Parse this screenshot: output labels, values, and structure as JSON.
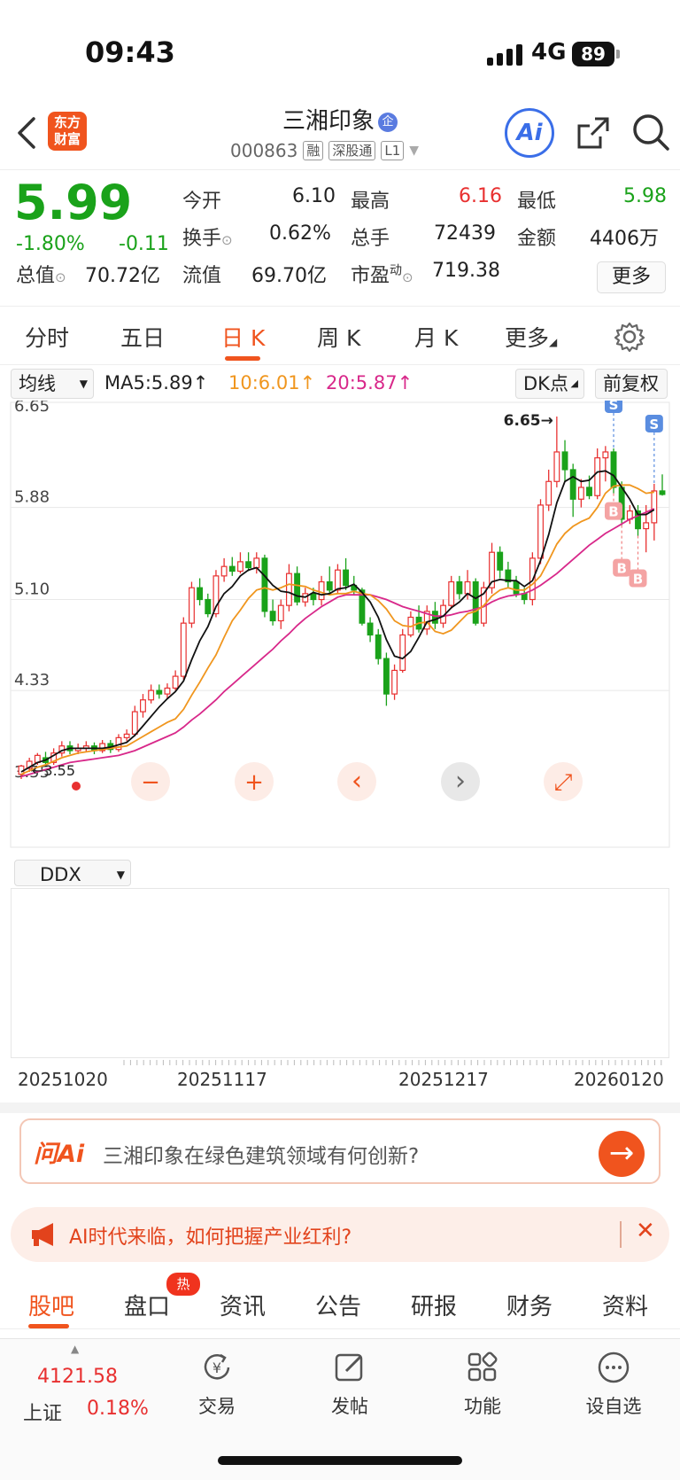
{
  "status": {
    "time": "09:43",
    "network": "4G",
    "battery": "89"
  },
  "header": {
    "logo_text": "东方财富",
    "title": "三湘印象",
    "badge": "企",
    "code": "000863",
    "tags": [
      "融",
      "深股通",
      "L1"
    ],
    "ai_label": "Ai"
  },
  "quote": {
    "price": "5.99",
    "pct": "-1.80%",
    "change": "-0.11",
    "rows": [
      [
        {
          "l": "今开",
          "v": "6.10",
          "c": "normal"
        },
        {
          "l": "最高",
          "v": "6.16",
          "c": "red"
        },
        {
          "l": "最低",
          "v": "5.98",
          "c": "green"
        }
      ],
      [
        {
          "l": "换手",
          "v": "0.62%",
          "c": "normal"
        },
        {
          "l": "总手",
          "v": "72439",
          "c": "normal"
        },
        {
          "l": "金额",
          "v": "4406万",
          "c": "normal"
        }
      ]
    ],
    "total_label": "总值",
    "total_value": "70.72亿",
    "float_label": "流值",
    "float_value": "69.70亿",
    "pe_label": "市盈",
    "pe_sup": "动",
    "pe_value": "719.38",
    "more_button": "更多"
  },
  "tabs": [
    "分时",
    "五日",
    "日 K",
    "周 K",
    "月 K",
    "更多"
  ],
  "active_tab": "日 K",
  "ma_bar": {
    "selector": "均线",
    "ma5": "MA5:5.89",
    "ma10": "10:6.01",
    "ma20": "20:5.87",
    "dk": "DK点",
    "adjust": "前复权"
  },
  "colors": {
    "up": "#e83030",
    "down": "#1aa21a",
    "ma5": "#111111",
    "ma10": "#f0961e",
    "ma20": "#d8288a",
    "accent": "#f0541e"
  },
  "chart_data": {
    "type": "candlestick",
    "y_ticks": [
      "6.65",
      "5.88",
      "5.10",
      "4.33",
      "3.55"
    ],
    "ylim": [
      3.55,
      6.65
    ],
    "max_marker": "6.65",
    "min_marker": "3.55",
    "x_ticks": [
      "20251020",
      "20251117",
      "20251217",
      "20260120"
    ],
    "candles": [
      [
        3.62,
        3.69,
        3.7,
        3.58
      ],
      [
        3.67,
        3.73,
        3.76,
        3.64
      ],
      [
        3.72,
        3.78,
        3.8,
        3.7
      ],
      [
        3.76,
        3.72,
        3.81,
        3.7
      ],
      [
        3.72,
        3.8,
        3.84,
        3.7
      ],
      [
        3.8,
        3.86,
        3.9,
        3.77
      ],
      [
        3.86,
        3.82,
        3.9,
        3.79
      ],
      [
        3.82,
        3.84,
        3.88,
        3.79
      ],
      [
        3.84,
        3.86,
        3.9,
        3.81
      ],
      [
        3.86,
        3.82,
        3.89,
        3.79
      ],
      [
        3.82,
        3.88,
        3.91,
        3.8
      ],
      [
        3.88,
        3.83,
        3.91,
        3.8
      ],
      [
        3.83,
        3.93,
        3.96,
        3.81
      ],
      [
        3.93,
        3.96,
        4.0,
        3.9
      ],
      [
        3.96,
        4.15,
        4.2,
        3.94
      ],
      [
        4.15,
        4.25,
        4.3,
        4.1
      ],
      [
        4.25,
        4.33,
        4.38,
        4.22
      ],
      [
        4.33,
        4.3,
        4.38,
        4.26
      ],
      [
        4.3,
        4.35,
        4.39,
        4.26
      ],
      [
        4.35,
        4.45,
        4.5,
        4.33
      ],
      [
        4.45,
        4.9,
        4.95,
        4.42
      ],
      [
        4.9,
        5.2,
        5.25,
        4.86
      ],
      [
        5.2,
        5.1,
        5.28,
        5.05
      ],
      [
        5.1,
        4.98,
        5.15,
        4.95
      ],
      [
        4.98,
        5.3,
        5.35,
        4.95
      ],
      [
        5.3,
        5.38,
        5.45,
        5.25
      ],
      [
        5.38,
        5.34,
        5.46,
        5.3
      ],
      [
        5.34,
        5.42,
        5.5,
        5.32
      ],
      [
        5.42,
        5.37,
        5.5,
        5.34
      ],
      [
        5.37,
        5.45,
        5.5,
        5.32
      ],
      [
        5.45,
        5.0,
        5.48,
        4.95
      ],
      [
        5.0,
        4.92,
        5.1,
        4.88
      ],
      [
        4.92,
        5.05,
        5.1,
        4.85
      ],
      [
        5.05,
        5.32,
        5.4,
        5.0
      ],
      [
        5.32,
        5.08,
        5.38,
        5.05
      ],
      [
        5.08,
        5.15,
        5.2,
        5.04
      ],
      [
        5.15,
        5.1,
        5.2,
        5.05
      ],
      [
        5.1,
        5.25,
        5.3,
        5.05
      ],
      [
        5.25,
        5.18,
        5.38,
        5.14
      ],
      [
        5.18,
        5.35,
        5.4,
        5.15
      ],
      [
        5.35,
        5.22,
        5.45,
        5.18
      ],
      [
        5.22,
        5.18,
        5.3,
        5.14
      ],
      [
        5.18,
        4.9,
        5.2,
        4.88
      ],
      [
        4.9,
        4.8,
        4.95,
        4.74
      ],
      [
        4.8,
        4.6,
        4.85,
        4.55
      ],
      [
        4.6,
        4.3,
        4.65,
        4.2
      ],
      [
        4.3,
        4.5,
        4.55,
        4.25
      ],
      [
        4.5,
        4.8,
        4.85,
        4.48
      ],
      [
        4.8,
        4.95,
        5.0,
        4.78
      ],
      [
        4.95,
        4.85,
        5.05,
        4.82
      ],
      [
        4.85,
        5.0,
        5.05,
        4.8
      ],
      [
        5.0,
        4.9,
        5.08,
        4.85
      ],
      [
        4.9,
        5.05,
        5.1,
        4.86
      ],
      [
        5.05,
        5.25,
        5.3,
        5.02
      ],
      [
        5.25,
        5.15,
        5.3,
        5.1
      ],
      [
        5.15,
        5.25,
        5.35,
        5.1
      ],
      [
        5.25,
        4.9,
        5.28,
        4.88
      ],
      [
        4.9,
        5.2,
        5.25,
        4.87
      ],
      [
        5.2,
        5.5,
        5.58,
        5.15
      ],
      [
        5.5,
        5.35,
        5.55,
        5.28
      ],
      [
        5.35,
        5.25,
        5.42,
        5.2
      ],
      [
        5.25,
        5.15,
        5.3,
        5.12
      ],
      [
        5.15,
        5.1,
        5.2,
        5.06
      ],
      [
        5.1,
        5.45,
        5.5,
        5.05
      ],
      [
        5.45,
        5.9,
        5.95,
        5.4
      ],
      [
        5.9,
        6.1,
        6.2,
        5.85
      ],
      [
        6.1,
        6.35,
        6.65,
        6.05
      ],
      [
        6.35,
        6.2,
        6.45,
        6.1
      ],
      [
        6.2,
        5.95,
        6.25,
        5.8
      ],
      [
        5.95,
        6.05,
        6.12,
        5.88
      ],
      [
        6.05,
        5.98,
        6.15,
        5.95
      ],
      [
        5.98,
        6.3,
        6.38,
        5.95
      ],
      [
        6.3,
        6.35,
        6.4,
        6.1
      ],
      [
        6.35,
        6.05,
        6.38,
        6.0
      ],
      [
        6.05,
        5.78,
        6.1,
        5.73
      ],
      [
        5.78,
        5.85,
        5.9,
        5.74
      ],
      [
        5.85,
        5.7,
        5.9,
        5.64
      ],
      [
        5.7,
        5.75,
        5.9,
        5.5
      ],
      [
        5.75,
        6.02,
        6.08,
        5.6
      ],
      [
        6.02,
        5.99,
        6.16,
        5.98
      ]
    ],
    "ma5": [
      3.64,
      3.68,
      3.72,
      3.74,
      3.78,
      3.82,
      3.84,
      3.84,
      3.84,
      3.84,
      3.84,
      3.85,
      3.87,
      3.89,
      3.95,
      4.03,
      4.11,
      4.19,
      4.26,
      4.32,
      4.41,
      4.59,
      4.75,
      4.87,
      5.04,
      5.15,
      5.21,
      5.3,
      5.35,
      5.37,
      5.3,
      5.22,
      5.17,
      5.16,
      5.13,
      5.12,
      5.16,
      5.14,
      5.15,
      5.19,
      5.2,
      5.23,
      5.16,
      5.08,
      4.95,
      4.76,
      4.62,
      4.6,
      4.66,
      4.78,
      4.91,
      4.93,
      4.96,
      5.03,
      5.08,
      5.15,
      5.11,
      5.15,
      5.25,
      5.27,
      5.26,
      5.26,
      5.21,
      5.26,
      5.43,
      5.65,
      5.92,
      6.1,
      6.14,
      6.1,
      6.11,
      6.18,
      6.19,
      6.15,
      6.05,
      5.95,
      5.82,
      5.82,
      5.86
    ],
    "ma10": [
      3.62,
      3.65,
      3.68,
      3.7,
      3.73,
      3.76,
      3.78,
      3.8,
      3.81,
      3.82,
      3.83,
      3.84,
      3.85,
      3.86,
      3.9,
      3.94,
      3.98,
      4.02,
      4.06,
      4.09,
      4.17,
      4.29,
      4.4,
      4.52,
      4.63,
      4.78,
      4.92,
      5.01,
      5.11,
      5.18,
      5.2,
      5.18,
      5.2,
      5.23,
      5.22,
      5.21,
      5.18,
      5.16,
      5.14,
      5.15,
      5.15,
      5.17,
      5.15,
      5.14,
      5.09,
      5.02,
      4.92,
      4.88,
      4.87,
      4.9,
      4.91,
      4.83,
      4.81,
      4.84,
      4.91,
      4.98,
      5.0,
      5.05,
      5.13,
      5.18,
      5.2,
      5.18,
      5.18,
      5.23,
      5.3,
      5.43,
      5.57,
      5.66,
      5.72,
      5.76,
      5.79,
      5.88,
      6.0,
      6.06,
      6.07,
      6.07,
      6.04,
      6.0,
      6.01
    ],
    "ma20": [
      3.6,
      3.62,
      3.64,
      3.66,
      3.68,
      3.7,
      3.72,
      3.73,
      3.74,
      3.75,
      3.76,
      3.77,
      3.78,
      3.8,
      3.82,
      3.85,
      3.88,
      3.91,
      3.94,
      3.97,
      4.02,
      4.08,
      4.13,
      4.19,
      4.25,
      4.32,
      4.38,
      4.44,
      4.5,
      4.56,
      4.62,
      4.68,
      4.75,
      4.81,
      4.88,
      4.94,
      4.99,
      5.04,
      5.08,
      5.12,
      5.14,
      5.14,
      5.14,
      5.14,
      5.12,
      5.1,
      5.07,
      5.04,
      5.02,
      5.0,
      4.98,
      4.96,
      4.96,
      4.97,
      4.99,
      5.0,
      5.02,
      5.04,
      5.08,
      5.11,
      5.13,
      5.14,
      5.15,
      5.18,
      5.22,
      5.27,
      5.32,
      5.38,
      5.44,
      5.5,
      5.56,
      5.61,
      5.66,
      5.7,
      5.74,
      5.78,
      5.81,
      5.84,
      5.87
    ],
    "signals": [
      {
        "type": "S",
        "candle": 73
      },
      {
        "type": "B",
        "candle": 73
      },
      {
        "type": "B",
        "candle": 74
      },
      {
        "type": "B",
        "candle": 76
      },
      {
        "type": "S",
        "candle": 78
      }
    ]
  },
  "chart_controls": [
    "zoom-out",
    "zoom-in",
    "prev",
    "next",
    "fullscreen"
  ],
  "indicator": {
    "selector": "DDX"
  },
  "ask": {
    "icon_text": "问Ai",
    "question": "三湘印象在绿色建筑领域有何创新?"
  },
  "banner": {
    "text": "AI时代来临，如何把握产业红利?"
  },
  "bottom_tabs": [
    "股吧",
    "盘口",
    "资讯",
    "公告",
    "研报",
    "财务",
    "资料"
  ],
  "hot_badge": "热",
  "index": {
    "value": "4121.58",
    "name": "上证",
    "pct": "0.18%"
  },
  "nav": [
    {
      "label": "交易",
      "icon": "trade-icon"
    },
    {
      "label": "发帖",
      "icon": "compose-icon"
    },
    {
      "label": "功能",
      "icon": "apps-icon"
    },
    {
      "label": "设自选",
      "icon": "more-dots-icon"
    }
  ]
}
